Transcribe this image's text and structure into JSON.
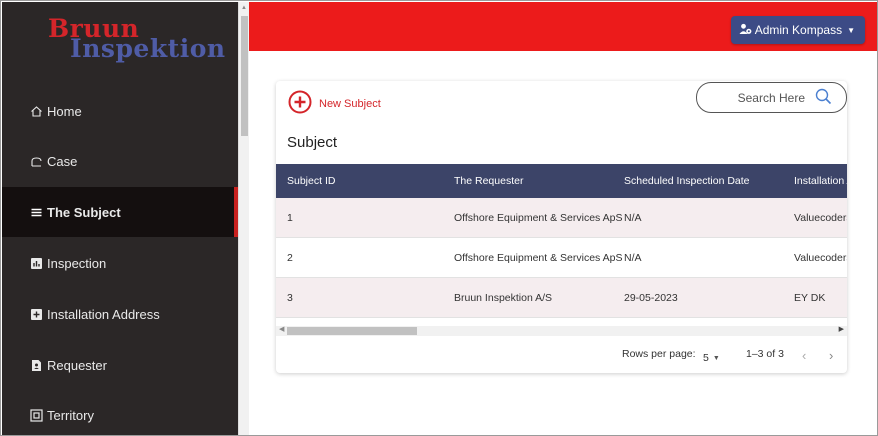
{
  "logo": {
    "line1": "Bruun",
    "line2": "Inspektion"
  },
  "sidebar": {
    "items": [
      {
        "label": "Home",
        "icon": "home-icon"
      },
      {
        "label": "Case",
        "icon": "case-icon"
      },
      {
        "label": "The Subject",
        "icon": "list-icon",
        "active": true
      },
      {
        "label": "Inspection",
        "icon": "inspection-icon"
      },
      {
        "label": "Installation Address",
        "icon": "address-icon"
      },
      {
        "label": "Requester",
        "icon": "requester-icon"
      },
      {
        "label": "Territory",
        "icon": "territory-icon"
      }
    ]
  },
  "header": {
    "user_label": "Admin Kompass"
  },
  "toolbar": {
    "new_label": "New Subject",
    "search_placeholder": "Search Here"
  },
  "table": {
    "title": "Subject",
    "columns": [
      "Subject ID",
      "The Requester",
      "Scheduled Inspection Date",
      "Installation A"
    ],
    "rows": [
      [
        "1",
        "Offshore Equipment & Services ApS",
        "N/A",
        "Valuecoders"
      ],
      [
        "2",
        "Offshore Equipment & Services ApS",
        "N/A",
        "Valuecoders"
      ],
      [
        "3",
        "Bruun Inspektion A/S",
        "29-05-2023",
        "EY DK"
      ]
    ]
  },
  "pagination": {
    "rows_per_page_label": "Rows per page:",
    "rows_per_page": "5",
    "range": "1–3 of 3"
  },
  "colors": {
    "brand_red": "#ec1b1b",
    "header_navy": "#3c4468",
    "button_navy": "#3c4b86",
    "sidebar_bg": "#2b2727"
  }
}
